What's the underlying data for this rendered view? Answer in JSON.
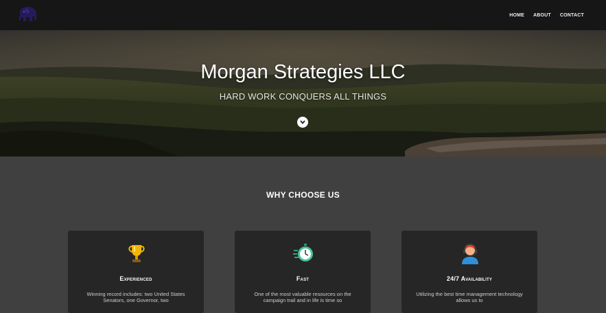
{
  "nav": {
    "logo": "elephant-logo-icon",
    "links": [
      "HOME",
      "ABOUT",
      "CONTACT"
    ]
  },
  "hero": {
    "title": "Morgan Strategies LLC",
    "subtitle": "HARD WORK CONQUERS ALL THINGS",
    "scroll_icon": "chevron-down-icon"
  },
  "features": {
    "title": "WHY CHOOSE US",
    "cards": [
      {
        "icon": "trophy-icon",
        "title": "Experienced",
        "text": "Winning record includes: two United States Senators, one Governor, two"
      },
      {
        "icon": "stopwatch-icon",
        "title": "Fast",
        "text": "One of the most valuable resources on the campaign trail and in life is time so"
      },
      {
        "icon": "support-agent-icon",
        "title": "24/7 Availability",
        "text": "Utilizing the best time management technology allows us to"
      }
    ]
  },
  "colors": {
    "navbar": "#161616",
    "page_background": "#404040",
    "card_background": "#262626",
    "logo": "#2a1f6b"
  }
}
